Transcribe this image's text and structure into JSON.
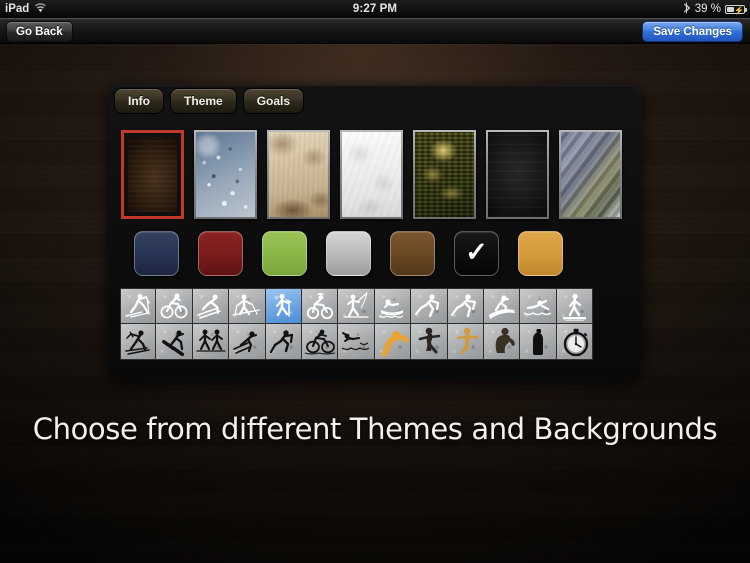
{
  "status_bar": {
    "device_label": "iPad",
    "wifi_icon": "wifi-icon",
    "time": "9:27 PM",
    "bluetooth_icon": "bluetooth-icon",
    "battery_percent": "39 %",
    "battery_icon": "battery-charging-icon"
  },
  "toolbar": {
    "back_label": "Go Back",
    "save_label": "Save Changes",
    "save_accent": "#2f6ed8"
  },
  "panel": {
    "tabs": [
      {
        "label": "Info",
        "selected": false
      },
      {
        "label": "Theme",
        "selected": true
      },
      {
        "label": "Goals",
        "selected": false
      }
    ],
    "selection_accent": "#c0392b",
    "textures": [
      {
        "name": "dark-wood-texture",
        "style": "tx-wood",
        "selected": true
      },
      {
        "name": "water-drops-texture",
        "style": "tx-water",
        "selected": false
      },
      {
        "name": "beige-grunge-texture",
        "style": "tx-beige",
        "selected": false
      },
      {
        "name": "white-marble-texture",
        "style": "tx-white",
        "selected": false
      },
      {
        "name": "olive-grunge-texture",
        "style": "tx-olive",
        "selected": false
      },
      {
        "name": "black-texture",
        "style": "tx-black",
        "selected": false
      },
      {
        "name": "blue-streak-texture",
        "style": "tx-streak",
        "selected": false
      }
    ],
    "colors": [
      {
        "name": "navy",
        "hex": "#283556",
        "selected": false
      },
      {
        "name": "dark-red",
        "hex": "#7c1d1d",
        "selected": false
      },
      {
        "name": "green",
        "hex": "#8cb84a",
        "selected": false
      },
      {
        "name": "silver",
        "hex": "#b0b0b0",
        "selected": false
      },
      {
        "name": "brown",
        "hex": "#6b4a24",
        "selected": false
      },
      {
        "name": "black",
        "hex": "#0d0d0d",
        "selected": true
      },
      {
        "name": "gold",
        "hex": "#d59b3c",
        "selected": false
      }
    ],
    "check_glyph": "✓",
    "icon_rows": [
      [
        {
          "name": "cross-country-ski-icon",
          "glyph": "xcski",
          "highlighted": false
        },
        {
          "name": "cycling-icon",
          "glyph": "bike",
          "highlighted": false
        },
        {
          "name": "downhill-ski-icon",
          "glyph": "downhill",
          "highlighted": false
        },
        {
          "name": "nordic-walking-icon",
          "glyph": "nordic",
          "highlighted": false
        },
        {
          "name": "hiking-icon",
          "glyph": "hiker",
          "highlighted": true
        },
        {
          "name": "mountain-bike-icon",
          "glyph": "mtb",
          "highlighted": false
        },
        {
          "name": "fishing-icon",
          "glyph": "fish",
          "highlighted": false
        },
        {
          "name": "rowing-icon",
          "glyph": "row",
          "highlighted": false
        },
        {
          "name": "running-icon",
          "glyph": "run",
          "highlighted": false
        },
        {
          "name": "sprint-icon",
          "glyph": "run2",
          "highlighted": false
        },
        {
          "name": "snowboard-icon",
          "glyph": "snowboard",
          "highlighted": false
        },
        {
          "name": "swimming-icon",
          "glyph": "swim",
          "highlighted": false
        },
        {
          "name": "treadmill-walk-icon",
          "glyph": "treadmill",
          "highlighted": false
        }
      ],
      [
        {
          "name": "biathlon-icon",
          "glyph": "biathlon",
          "highlighted": false
        },
        {
          "name": "ski-jump-icon",
          "glyph": "skijump",
          "highlighted": false
        },
        {
          "name": "team-skate-icon",
          "glyph": "team",
          "highlighted": false
        },
        {
          "name": "alpine-ski-icon",
          "glyph": "alpine",
          "highlighted": false
        },
        {
          "name": "sprinter-icon",
          "glyph": "sprinter",
          "highlighted": false
        },
        {
          "name": "road-cycling-icon",
          "glyph": "roadbike",
          "highlighted": false
        },
        {
          "name": "open-water-swim-icon",
          "glyph": "openswim",
          "highlighted": false
        },
        {
          "name": "orange-crouch-icon",
          "glyph": "crouch",
          "highlighted": false
        },
        {
          "name": "dark-runner-icon",
          "glyph": "darkrun",
          "highlighted": false
        },
        {
          "name": "gold-runner-icon",
          "glyph": "goldrun",
          "highlighted": false
        },
        {
          "name": "heavy-runner-icon",
          "glyph": "heavy",
          "highlighted": false
        },
        {
          "name": "water-bottle-icon",
          "glyph": "bottle",
          "highlighted": false
        },
        {
          "name": "stopwatch-icon",
          "glyph": "stopwatch",
          "highlighted": false
        }
      ]
    ]
  },
  "caption": {
    "text": "Choose from different Themes and Backgrounds"
  }
}
